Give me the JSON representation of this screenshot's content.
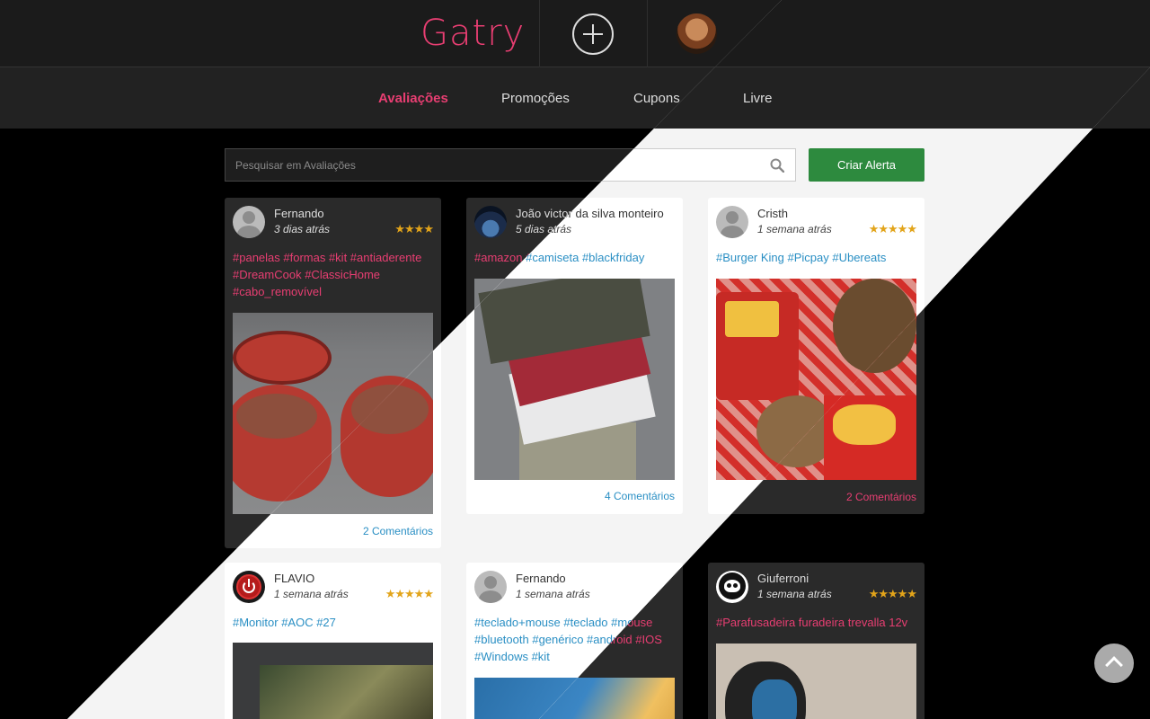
{
  "header": {
    "logo": "Gatry",
    "add_label": "add",
    "nav": [
      "Avaliações",
      "Promoções",
      "Cupons",
      "Livre"
    ],
    "active_nav": "Avaliações"
  },
  "search": {
    "placeholder": "Pesquisar em Avaliações",
    "alert_button": "Criar Alerta"
  },
  "cards": [
    {
      "user": "Fernando",
      "time": "3 dias atrás",
      "stars": "★★★★",
      "tags": "#panelas #formas #kit #antiaderente #DreamCook #ClassicHome #cabo_removível",
      "comments": "2 Comentários"
    },
    {
      "user": "João victor da silva monteiro",
      "time": "5 dias atrás",
      "stars": "",
      "tags": "#amazon #camiseta #blackfriday",
      "comments": "4 Comentários"
    },
    {
      "user": "Cristh",
      "time": "1 semana atrás",
      "stars": "★★★★★",
      "tags": "#Burger King #Picpay #Ubereats",
      "comments": "2 Comentários"
    },
    {
      "user": "FLAVIO",
      "time": "1 semana atrás",
      "stars": "★★★★★",
      "tags": "#Monitor #AOC #27",
      "comments": ""
    },
    {
      "user": "Fernando",
      "time": "1 semana atrás",
      "stars": "",
      "tags": "#teclado+mouse #teclado #mouse #bluetooth #genérico #android #IOS #Windows #kit",
      "comments": ""
    },
    {
      "user": "Giuferroni",
      "time": "1 semana atrás",
      "stars": "★★★★★",
      "tags": "#Parafusadeira furadeira trevalla 12v",
      "comments": ""
    }
  ],
  "colors": {
    "accent_dark": "#e83e72",
    "accent_light": "#2a8fc4",
    "star": "#e2a41a",
    "alert_button": "#2d8a3e"
  }
}
